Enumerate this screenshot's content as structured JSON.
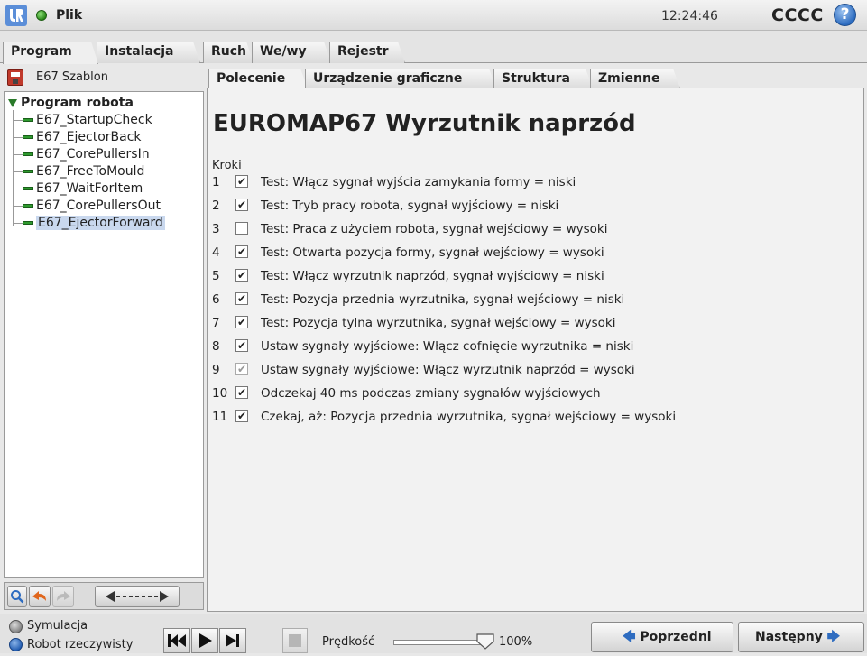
{
  "topbar": {
    "file_menu": "Plik",
    "clock": "12:24:46",
    "robot_name": "CCCC",
    "help": "?"
  },
  "main_tabs": [
    "Program",
    "Instalacja",
    "Ruch",
    "We/wy",
    "Rejestr"
  ],
  "program": {
    "name": "E67 Szablon",
    "tree_root": "Program robota",
    "tree_items": [
      "E67_StartupCheck",
      "E67_EjectorBack",
      "E67_CorePullersIn",
      "E67_FreeToMould",
      "E67_WaitForItem",
      "E67_CorePullersOut",
      "E67_EjectorForward"
    ],
    "selected_index": 6
  },
  "sub_tabs": [
    "Polecenie",
    "Urządzenie graficzne",
    "Struktura",
    "Zmienne"
  ],
  "content": {
    "title": "EUROMAP67 Wyrzutnik naprzód",
    "steps_label": "Kroki",
    "steps": [
      {
        "num": "1",
        "checked": true,
        "text": "Test: Włącz sygnał wyjścia zamykania formy = niski"
      },
      {
        "num": "2",
        "checked": true,
        "text": "Test: Tryb pracy robota, sygnał wyjściowy = niski"
      },
      {
        "num": "3",
        "checked": false,
        "text": "Test: Praca z użyciem robota, sygnał wejściowy = wysoki"
      },
      {
        "num": "4",
        "checked": true,
        "text": "Test: Otwarta pozycja formy, sygnał wejściowy = wysoki"
      },
      {
        "num": "5",
        "checked": true,
        "text": "Test: Włącz wyrzutnik naprzód, sygnał wyjściowy = niski"
      },
      {
        "num": "6",
        "checked": true,
        "text": "Test: Pozycja przednia wyrzutnika, sygnał wejściowy = niski"
      },
      {
        "num": "7",
        "checked": true,
        "text": "Test: Pozycja tylna wyrzutnika, sygnał wejściowy = wysoki"
      },
      {
        "num": "8",
        "checked": true,
        "text": "Ustaw sygnały wyjściowe: Włącz cofnięcie wyrzutnika = niski"
      },
      {
        "num": "9",
        "checked": true,
        "disabled": true,
        "text": "Ustaw sygnały wyjściowe: Włącz wyrzutnik naprzód = wysoki"
      },
      {
        "num": "10",
        "checked": true,
        "text": "Odczekaj 40 ms podczas zmiany sygnałów wyjściowych"
      },
      {
        "num": "11",
        "checked": true,
        "text": "Czekaj, aż: Pozycja przednia wyrzutnika, sygnał wejściowy = wysoki"
      }
    ]
  },
  "bottom": {
    "simulation_label": "Symulacja",
    "real_robot_label": "Robot rzeczywisty",
    "speed_label": "Prędkość",
    "speed_value": "100%",
    "speed_fraction": 1.0,
    "prev_label": "Poprzedni",
    "next_label": "Następny"
  },
  "colors": {
    "accent_blue": "#2e6cc0",
    "command_green": "#2e9a2e",
    "selection": "#c9d8ee"
  }
}
